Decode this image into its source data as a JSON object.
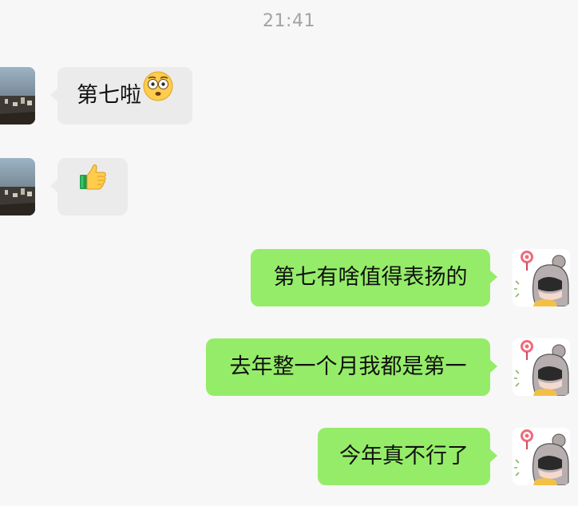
{
  "chat": {
    "timestamp": "21:41",
    "messages": [
      {
        "side": "left",
        "text": "第七啦",
        "emoji": "flushed-face-icon"
      },
      {
        "side": "left",
        "text": "",
        "emoji": "thumbs-up-icon"
      },
      {
        "side": "right",
        "text": "第七有啥值得表扬的"
      },
      {
        "side": "right",
        "text": "去年整一个月我都是第一"
      },
      {
        "side": "right",
        "text": "今年真不行了"
      }
    ]
  },
  "colors": {
    "background": "#f7f7f7",
    "incoming_bubble": "#ebebeb",
    "outgoing_bubble": "#95ec69",
    "timestamp_text": "#a3a3a3"
  }
}
